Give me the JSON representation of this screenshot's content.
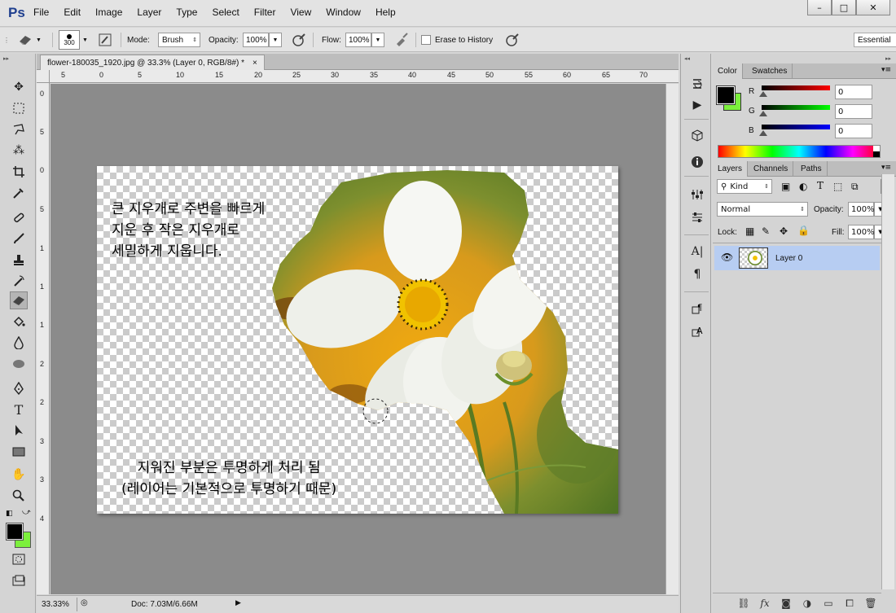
{
  "menubar": {
    "logo": "Ps",
    "items": [
      "File",
      "Edit",
      "Image",
      "Layer",
      "Type",
      "Select",
      "Filter",
      "View",
      "Window",
      "Help"
    ],
    "window_controls": [
      "–",
      "□",
      "✕"
    ]
  },
  "options": {
    "brush_size": "300",
    "mode_label": "Mode:",
    "mode_value": "Brush",
    "opacity_label": "Opacity:",
    "opacity_value": "100%",
    "flow_label": "Flow:",
    "flow_value": "100%",
    "erase_history_label": "Erase to History",
    "workspace_label": "Essential"
  },
  "document": {
    "tab_title": "flower-180035_1920.jpg @ 33.3% (Layer 0, RGB/8#) *",
    "tab_close": "×",
    "hruler_ticks": [
      "5",
      "0",
      "5",
      "10",
      "15",
      "20",
      "25",
      "30",
      "35",
      "40",
      "45",
      "50",
      "55",
      "60",
      "65",
      "70"
    ],
    "vruler_ticks": [
      "0",
      "5",
      "0",
      "5",
      "1",
      "1",
      "1",
      "2",
      "2",
      "3",
      "3",
      "4"
    ],
    "note_top": [
      "큰 지우개로 주변을 빠르게",
      "지운 후 작은 지우개로",
      "세밀하게 지웁니다."
    ],
    "note_bottom": [
      "지워진 부분은 투명하게 처리 됨",
      "(레이어는 기본적으로 투명하기 때문)"
    ]
  },
  "status": {
    "zoom": "33.33%",
    "doc_info": "Doc: 7.03M/6.66M"
  },
  "color_panel": {
    "tabs": [
      "Color",
      "Swatches"
    ],
    "r_label": "R",
    "r_value": "0",
    "g_label": "G",
    "g_value": "0",
    "b_label": "B",
    "b_value": "0"
  },
  "layers_panel": {
    "tabs": [
      "Layers",
      "Channels",
      "Paths"
    ],
    "kind_label": "Kind",
    "blend_mode": "Normal",
    "opacity_label": "Opacity:",
    "opacity_value": "100%",
    "lock_label": "Lock:",
    "fill_label": "Fill:",
    "fill_value": "100%",
    "layer_name": "Layer 0"
  },
  "colors": {
    "foreground": "#000000",
    "background": "#7cf03c",
    "selection": "#b7cdf2"
  }
}
